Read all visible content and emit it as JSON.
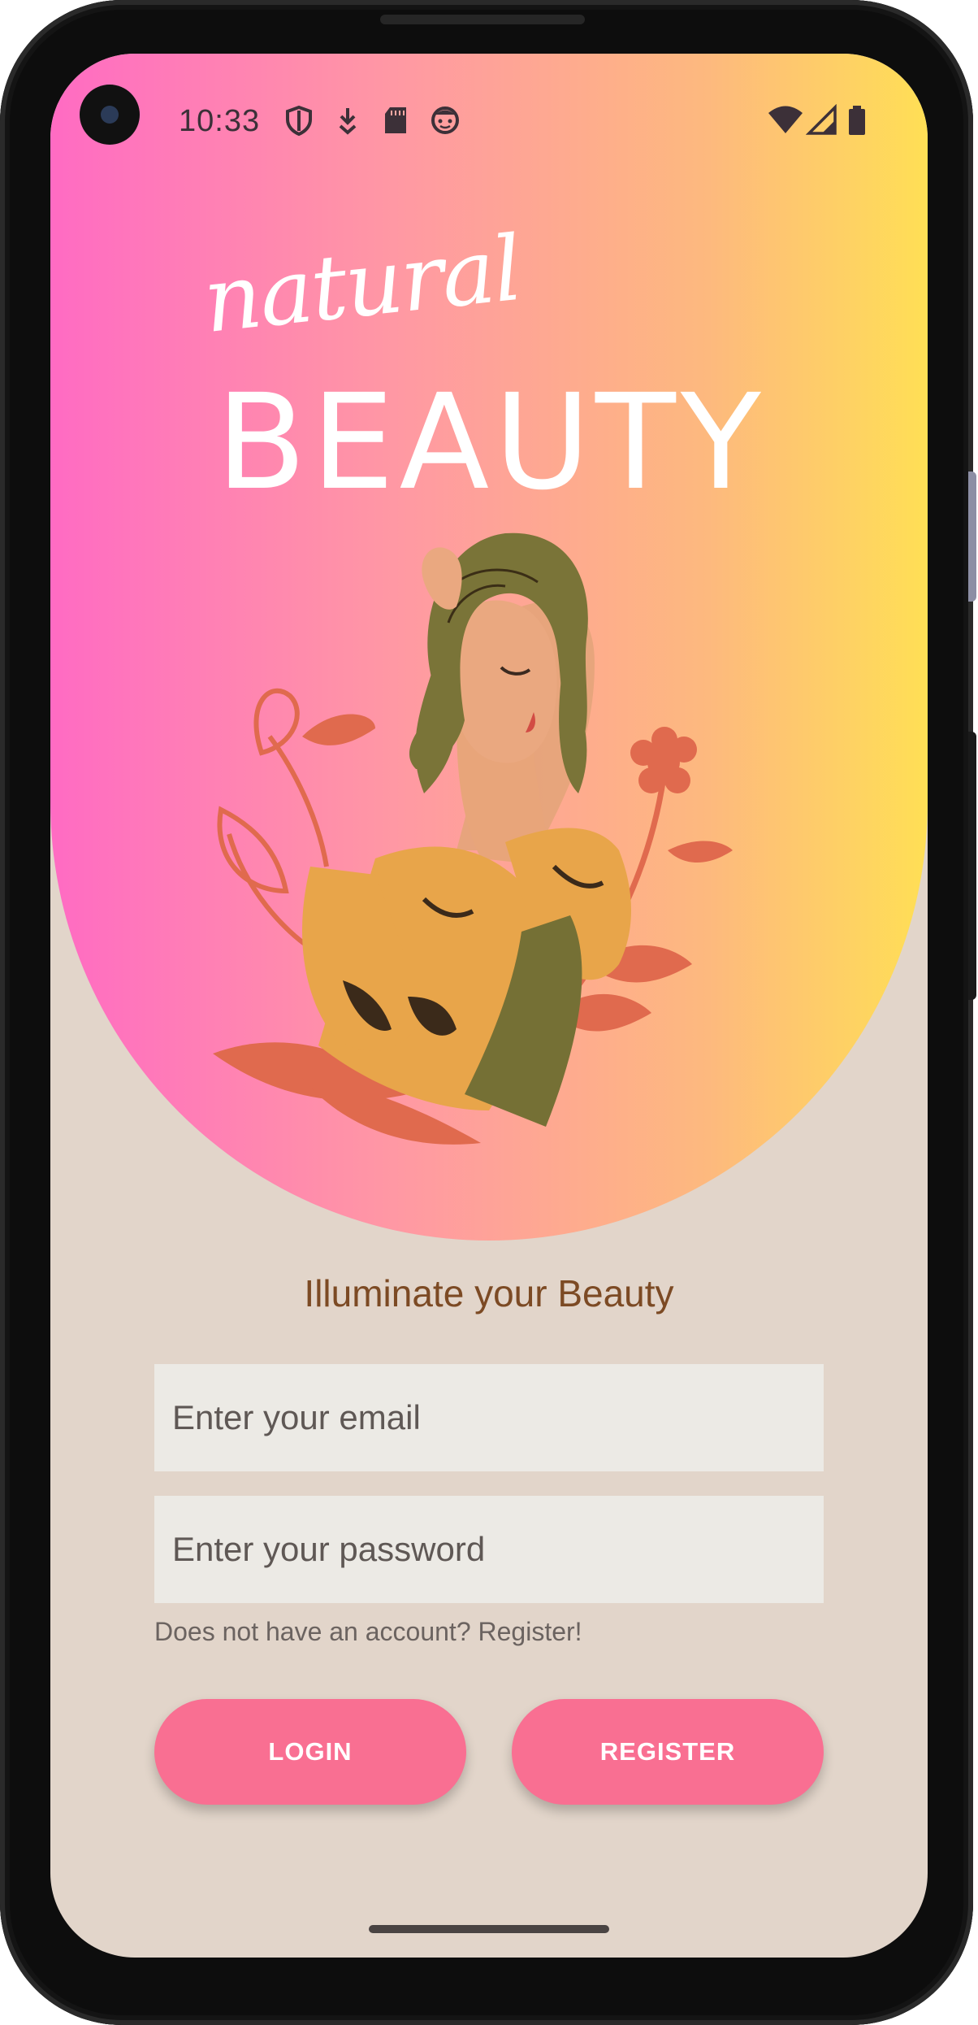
{
  "status_bar": {
    "time": "10:33",
    "left_icons": [
      "shield-icon",
      "download-icon",
      "sd-card-icon",
      "face-icon"
    ],
    "right_icons": [
      "wifi-icon",
      "signal-icon",
      "battery-icon"
    ]
  },
  "hero": {
    "logo_script": "natural",
    "logo_title": "BEAUTY",
    "gradient_colors": [
      "#ff6bc3",
      "#ff99a3",
      "#fdb97e",
      "#ffdf55"
    ]
  },
  "login": {
    "tagline": "Illuminate your Beauty",
    "email_placeholder": "Enter your email",
    "password_placeholder": "Enter your password",
    "register_hint": "Does not have an account? Register!",
    "login_label": "LOGIN",
    "register_label": "REGISTER"
  },
  "colors": {
    "background": "#e2d5ca",
    "button": "#f96f92",
    "tagline": "#7c4a24",
    "field": "#eceae5"
  }
}
